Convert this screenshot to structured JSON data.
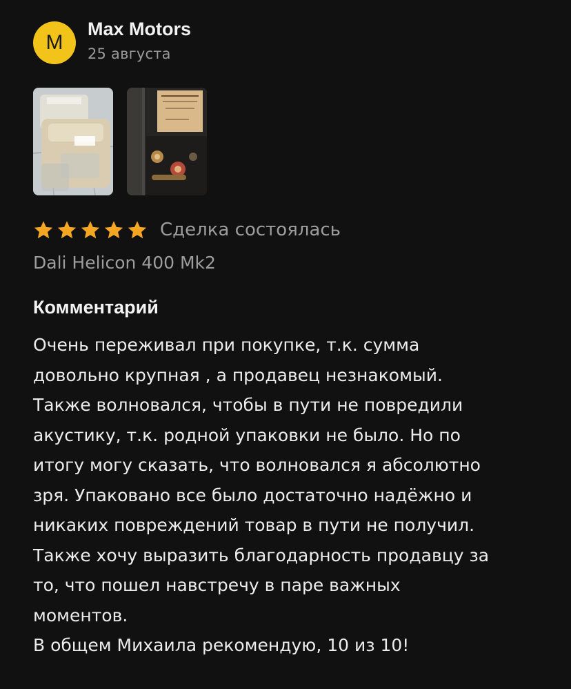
{
  "review": {
    "avatar_letter": "M",
    "author": "Max Motors",
    "date": "25 августа",
    "photos": [
      {
        "alt": "speakers-in-packaging"
      },
      {
        "alt": "speaker-rear-panel"
      }
    ],
    "photo_label_lines": [
      "DALI HELICON 400 MK2"
    ],
    "rating": 5,
    "deal_status": "Сделка состоялась",
    "product": "Dali Helicon 400 Mk2",
    "comment_heading": "Комментарий",
    "comment_text": "Очень переживал при покупке, т.к. сумма\nдовольно крупная , а продавец незнакомый.\nТакже волновался, чтобы в пути не повредили\nакустику, т.к. родной упаковки не было. Но по\nитогу могу сказать, что волновался я абсолютно\nзря. Упаковано все было достаточно надёжно и\nникаких повреждений товар в пути не получил.\nТакже хочу выразить благодарность продавцу за\nто, что пошел навстречу в паре важных\nмоментов.\nВ общем Михаила рекомендую, 10 из 10!"
  },
  "colors": {
    "background": "#111111",
    "avatar": "#f2c318",
    "star": "#f5a623",
    "muted_text": "#9d9d9d"
  },
  "icons": {
    "star": "star-icon"
  }
}
